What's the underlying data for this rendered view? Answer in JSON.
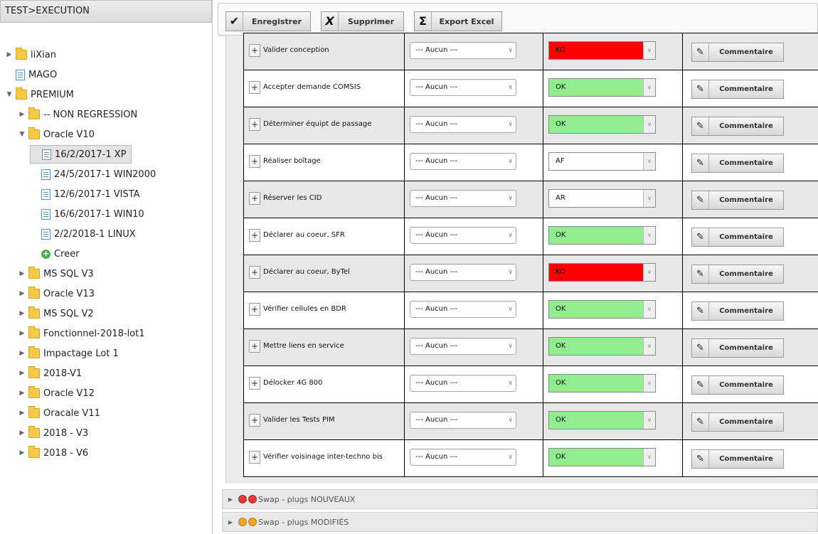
{
  "colors": {
    "ko": "#ff0000",
    "ok": "#90ee90",
    "neutral": "#ffffff",
    "dot_red": "#e53935",
    "dot_orange": "#f5a623"
  },
  "panel": {
    "title": "TEST>EXECUTION"
  },
  "tree": [
    {
      "label": "liXian",
      "icon": "folder-icon",
      "level": 0,
      "arrow": "right"
    },
    {
      "label": "MAGO",
      "icon": "document-icon",
      "level": 0,
      "arrow": ""
    },
    {
      "label": "PREMIUM",
      "icon": "folder-icon",
      "level": 0,
      "arrow": "down"
    },
    {
      "label": "-- NON REGRESSION",
      "icon": "folder-icon",
      "level": 1,
      "arrow": "right"
    },
    {
      "label": "Oracle V10",
      "icon": "folder-icon",
      "level": 1,
      "arrow": "down"
    },
    {
      "label": "16/2/2017-1 XP",
      "icon": "document-icon",
      "level": 2,
      "arrow": "",
      "selected": true
    },
    {
      "label": "24/5/2017-1 WIN2000",
      "icon": "document-icon",
      "level": 2,
      "arrow": ""
    },
    {
      "label": "12/6/2017-1 VISTA",
      "icon": "document-icon",
      "level": 2,
      "arrow": ""
    },
    {
      "label": "16/6/2017-1 WIN10",
      "icon": "document-icon",
      "level": 2,
      "arrow": ""
    },
    {
      "label": "2/2/2018-1 LINUX",
      "icon": "document-icon",
      "level": 2,
      "arrow": ""
    },
    {
      "label": "Creer",
      "icon": "add-icon",
      "level": 2,
      "arrow": ""
    },
    {
      "label": "MS SQL V3",
      "icon": "folder-icon",
      "level": 1,
      "arrow": "right"
    },
    {
      "label": "Oracle V13",
      "icon": "folder-icon",
      "level": 1,
      "arrow": "right"
    },
    {
      "label": "MS SQL V2",
      "icon": "folder-icon",
      "level": 1,
      "arrow": "right"
    },
    {
      "label": "Fonctionnel-2018-lot1",
      "icon": "folder-icon",
      "level": 1,
      "arrow": "right"
    },
    {
      "label": "Impactage Lot 1",
      "icon": "folder-icon",
      "level": 1,
      "arrow": "right"
    },
    {
      "label": "2018-V1",
      "icon": "folder-icon",
      "level": 1,
      "arrow": "right"
    },
    {
      "label": "Oracle V12",
      "icon": "folder-icon",
      "level": 1,
      "arrow": "right"
    },
    {
      "label": "Oracale V11",
      "icon": "folder-icon",
      "level": 1,
      "arrow": "right"
    },
    {
      "label": "2018 - V3",
      "icon": "folder-icon",
      "level": 1,
      "arrow": "right"
    },
    {
      "label": "2018 - V6",
      "icon": "folder-icon",
      "level": 1,
      "arrow": "right"
    }
  ],
  "toolbar": {
    "save_label": "Enregistrer",
    "save_icon": "check-icon",
    "delete_label": "Supprimer",
    "delete_icon": "cross-icon",
    "export_label": "Export Excel",
    "export_icon": "sigma-icon"
  },
  "rows": [
    {
      "task": "Valider conception",
      "select": "--- Aucun ---",
      "status": "KO"
    },
    {
      "task": "Accepter demande COMSIS",
      "select": "--- Aucun ---",
      "status": "OK"
    },
    {
      "task": "Déterminer équipt de passage",
      "select": "--- Aucun ---",
      "status": "OK"
    },
    {
      "task": "Réaliser boîtage",
      "select": "--- Aucun ---",
      "status": "AF"
    },
    {
      "task": "Réserver les CID",
      "select": "--- Aucun ---",
      "status": "AR"
    },
    {
      "task": "Déclarer au coeur, SFR",
      "select": "--- Aucun ---",
      "status": "OK"
    },
    {
      "task": "Déclarer au coeur, ByTel",
      "select": "--- Aucun ---",
      "status": "KO"
    },
    {
      "task": "Vérifier cellules en BDR",
      "select": "--- Aucun ---",
      "status": "OK"
    },
    {
      "task": "Mettre liens en service",
      "select": "--- Aucun ---",
      "status": "OK"
    },
    {
      "task": "Délocker 4G 800",
      "select": "--- Aucun ---",
      "status": "OK"
    },
    {
      "task": "Valider les Tests PIM",
      "select": "--- Aucun ---",
      "status": "OK"
    },
    {
      "task": "Vérifier voisinage inter-techno bis",
      "select": "--- Aucun ---",
      "status": "OK"
    }
  ],
  "comment_label": "Commentaire",
  "comment_icon": "pencil-icon",
  "sections": [
    {
      "label": "Swap - plugs NOUVEAUX",
      "dots": "red"
    },
    {
      "label": "Swap - plugs MODIFIÉS",
      "dots": "orange"
    }
  ]
}
